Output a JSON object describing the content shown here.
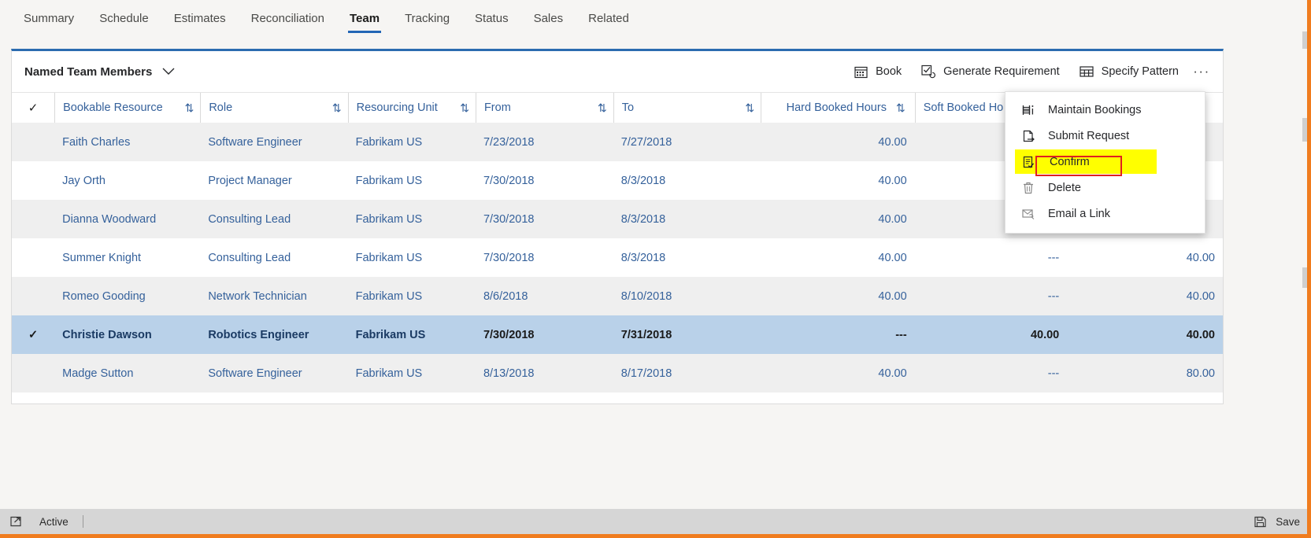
{
  "tabs": [
    {
      "label": "Summary",
      "active": false
    },
    {
      "label": "Schedule",
      "active": false
    },
    {
      "label": "Estimates",
      "active": false
    },
    {
      "label": "Reconciliation",
      "active": false
    },
    {
      "label": "Team",
      "active": true
    },
    {
      "label": "Tracking",
      "active": false
    },
    {
      "label": "Status",
      "active": false
    },
    {
      "label": "Sales",
      "active": false
    },
    {
      "label": "Related",
      "active": false
    }
  ],
  "panel": {
    "title": "Named Team Members",
    "commands": [
      {
        "label": "Book",
        "icon": "calendar-icon"
      },
      {
        "label": "Generate Requirement",
        "icon": "checkbox-refresh-icon"
      },
      {
        "label": "Specify Pattern",
        "icon": "grid-table-icon"
      }
    ],
    "overflow_label": "···"
  },
  "grid": {
    "columns": [
      {
        "key": "check",
        "label": "✓",
        "align": "center"
      },
      {
        "key": "resource",
        "label": "Bookable Resource",
        "align": "left",
        "sortable": true
      },
      {
        "key": "role",
        "label": "Role",
        "align": "left",
        "sortable": true
      },
      {
        "key": "unit",
        "label": "Resourcing Unit",
        "align": "left",
        "sortable": true
      },
      {
        "key": "from",
        "label": "From",
        "align": "left",
        "sortable": true
      },
      {
        "key": "to",
        "label": "To",
        "align": "left",
        "sortable": true
      },
      {
        "key": "hard",
        "label": "Hard Booked Hours",
        "align": "right",
        "sortable": true
      },
      {
        "key": "soft",
        "label": "Soft Booked Ho",
        "align": "right",
        "sortable": false
      },
      {
        "key": "total",
        "label": "",
        "align": "right",
        "sortable": false
      }
    ],
    "sort_glyph": "⇅",
    "check_glyph": "✓",
    "rows": [
      {
        "selected": false,
        "check": "",
        "resource": "Faith Charles",
        "role": "Software Engineer",
        "unit": "Fabrikam US",
        "from": "7/23/2018",
        "to": "7/27/2018",
        "hard": "40.00",
        "soft": "",
        "total": ""
      },
      {
        "selected": false,
        "check": "",
        "resource": "Jay Orth",
        "role": "Project Manager",
        "unit": "Fabrikam US",
        "from": "7/30/2018",
        "to": "8/3/2018",
        "hard": "40.00",
        "soft": "",
        "total": ""
      },
      {
        "selected": false,
        "check": "",
        "resource": "Dianna Woodward",
        "role": "Consulting Lead",
        "unit": "Fabrikam US",
        "from": "7/30/2018",
        "to": "8/3/2018",
        "hard": "40.00",
        "soft": "",
        "total": ""
      },
      {
        "selected": false,
        "check": "",
        "resource": "Summer Knight",
        "role": "Consulting Lead",
        "unit": "Fabrikam US",
        "from": "7/30/2018",
        "to": "8/3/2018",
        "hard": "40.00",
        "soft": "---",
        "total": "40.00"
      },
      {
        "selected": false,
        "check": "",
        "resource": "Romeo Gooding",
        "role": "Network Technician",
        "unit": "Fabrikam US",
        "from": "8/6/2018",
        "to": "8/10/2018",
        "hard": "40.00",
        "soft": "---",
        "total": "40.00"
      },
      {
        "selected": true,
        "check": "✓",
        "resource": "Christie Dawson",
        "role": "Robotics Engineer",
        "unit": "Fabrikam US",
        "from": "7/30/2018",
        "to": "7/31/2018",
        "hard": "---",
        "soft": "40.00",
        "total": "40.00"
      },
      {
        "selected": false,
        "check": "",
        "resource": "Madge Sutton",
        "role": "Software Engineer",
        "unit": "Fabrikam US",
        "from": "8/13/2018",
        "to": "8/17/2018",
        "hard": "40.00",
        "soft": "---",
        "total": "80.00"
      }
    ]
  },
  "context_menu": {
    "items": [
      {
        "label": "Maintain Bookings",
        "icon": "maintain-bookings-icon",
        "highlighted": false
      },
      {
        "label": "Submit Request",
        "icon": "submit-request-icon",
        "highlighted": false
      },
      {
        "label": "Confirm",
        "icon": "confirm-icon",
        "highlighted": true
      },
      {
        "label": "Delete",
        "icon": "trash-icon",
        "highlighted": false
      },
      {
        "label": "Email a Link",
        "icon": "email-link-icon",
        "highlighted": false
      }
    ],
    "highlight_color": "#ffff00",
    "annotation_box_color": "#e02020"
  },
  "statusbar": {
    "status": "Active",
    "save_label": "Save",
    "status_icon": "popout-icon",
    "save_icon": "floppy-save-icon"
  },
  "colors": {
    "accent": "#2b6cb0",
    "link": "#35619b",
    "selected_row": "#b9d1e9",
    "alt_row": "#efefef",
    "orange_border": "#f07c1e"
  }
}
